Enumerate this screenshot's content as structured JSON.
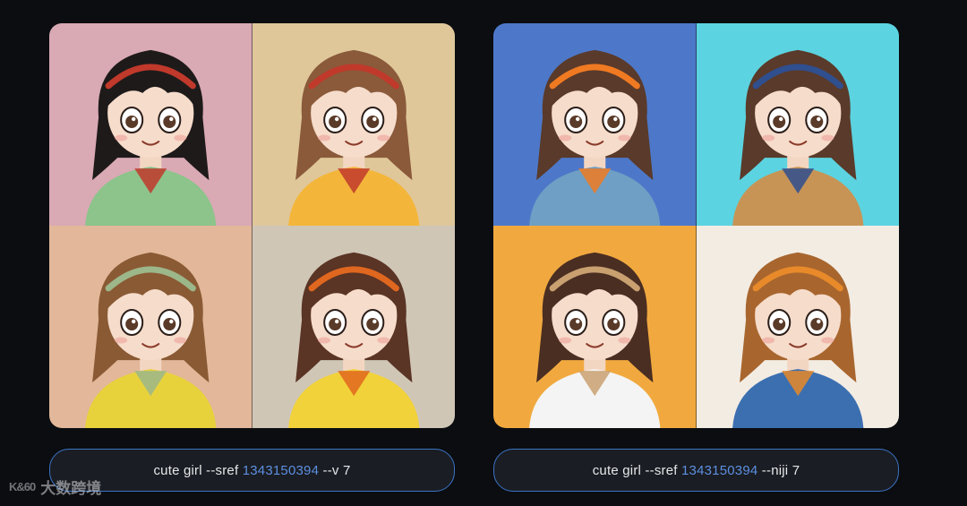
{
  "colors": {
    "page_background": "#0b0d10",
    "prompt_border": "#3a73c4",
    "prompt_number": "#5c8fe0",
    "tile_pink": "#d9a9b4",
    "tile_beige": "#dfc79a",
    "tile_peach": "#e2b79a",
    "tile_grey": "#cfc6b6",
    "tile_blue": "#4d78c9",
    "tile_cyan": "#5cd3e0",
    "tile_orange": "#f1a93f",
    "tile_cream": "#f3ece3"
  },
  "left_panel": {
    "images": [
      {
        "name": "girl-with-goggles-image",
        "bg": "#d9a9b4",
        "hair": "#1e1a1a",
        "shirt": "#8cc48b",
        "accent": "#c0392b"
      },
      {
        "name": "girl-with-headband-image",
        "bg": "#dfc79a",
        "hair": "#8a5a3a",
        "shirt": "#f4b63a",
        "accent": "#c0392b"
      },
      {
        "name": "girl-with-headphones-image",
        "bg": "#e2b79a",
        "hair": "#8a5a34",
        "shirt": "#e8d23c",
        "accent": "#9cb78a"
      },
      {
        "name": "girl-with-bow-image",
        "bg": "#cfc6b6",
        "hair": "#5a3424",
        "shirt": "#f2d23a",
        "accent": "#e0671f"
      }
    ],
    "prompt": {
      "before": "cute girl --sref ",
      "number": "1343150394",
      "after": " --v 7"
    }
  },
  "right_panel": {
    "images": [
      {
        "name": "girl-blue-background-image",
        "bg": "#4d78c9",
        "hair": "#5a3a2a",
        "shirt": "#6f9fc4",
        "accent": "#f07a22"
      },
      {
        "name": "girl-cyan-background-image",
        "bg": "#5cd3e0",
        "hair": "#5a3a2a",
        "shirt": "#c79455",
        "accent": "#2f4f8f"
      },
      {
        "name": "girl-orange-background-image",
        "bg": "#f1a93f",
        "hair": "#4a2e22",
        "shirt": "#f4f4f4",
        "accent": "#c9a070"
      },
      {
        "name": "girl-cream-background-image",
        "bg": "#f3ece3",
        "hair": "#a8662e",
        "shirt": "#3b6fb0",
        "accent": "#e88a2a"
      }
    ],
    "prompt": {
      "before": "cute girl --sref ",
      "number": "1343150394",
      "after": " --niji 7"
    }
  },
  "watermark": {
    "logo": "K&60",
    "text": "大数跨境"
  }
}
